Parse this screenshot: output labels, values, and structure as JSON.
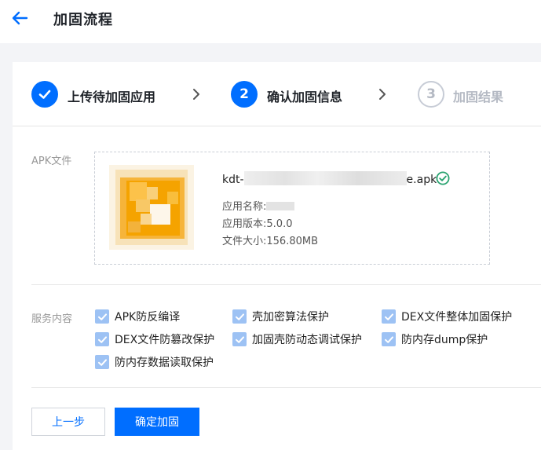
{
  "header": {
    "title": "加固流程"
  },
  "steps": [
    {
      "label": "上传待加固应用",
      "state": "done"
    },
    {
      "label": "确认加固信息",
      "number": "2",
      "state": "active"
    },
    {
      "label": "加固结果",
      "number": "3",
      "state": "pending"
    }
  ],
  "apk": {
    "section_label": "APK文件",
    "file_name_prefix": "kdt-",
    "file_name_suffix": "e.apk",
    "app_name_label": "应用名称:",
    "app_version_label": "应用版本:",
    "app_version": "5.0.0",
    "file_size_label": "文件大小:",
    "file_size": "156.80MB"
  },
  "services": {
    "section_label": "服务内容",
    "items": [
      {
        "label": "APK防反编译",
        "checked": true
      },
      {
        "label": "壳加密算法保护",
        "checked": true
      },
      {
        "label": "DEX文件整体加固保护",
        "checked": true
      },
      {
        "label": "DEX文件防篡改保护",
        "checked": true
      },
      {
        "label": "加固壳防动态调试保护",
        "checked": true
      },
      {
        "label": "防内存dump保护",
        "checked": true
      },
      {
        "label": "防内存数据读取保护",
        "checked": true
      }
    ]
  },
  "buttons": {
    "prev": "上一步",
    "confirm": "确定加固"
  },
  "colors": {
    "primary": "#006eff",
    "checkbox": "#9dc2f4",
    "success": "#2ba471"
  },
  "icons": [
    "back-arrow-icon",
    "checkmark-icon",
    "chevron-right-icon",
    "success-check-icon",
    "app-icon"
  ]
}
